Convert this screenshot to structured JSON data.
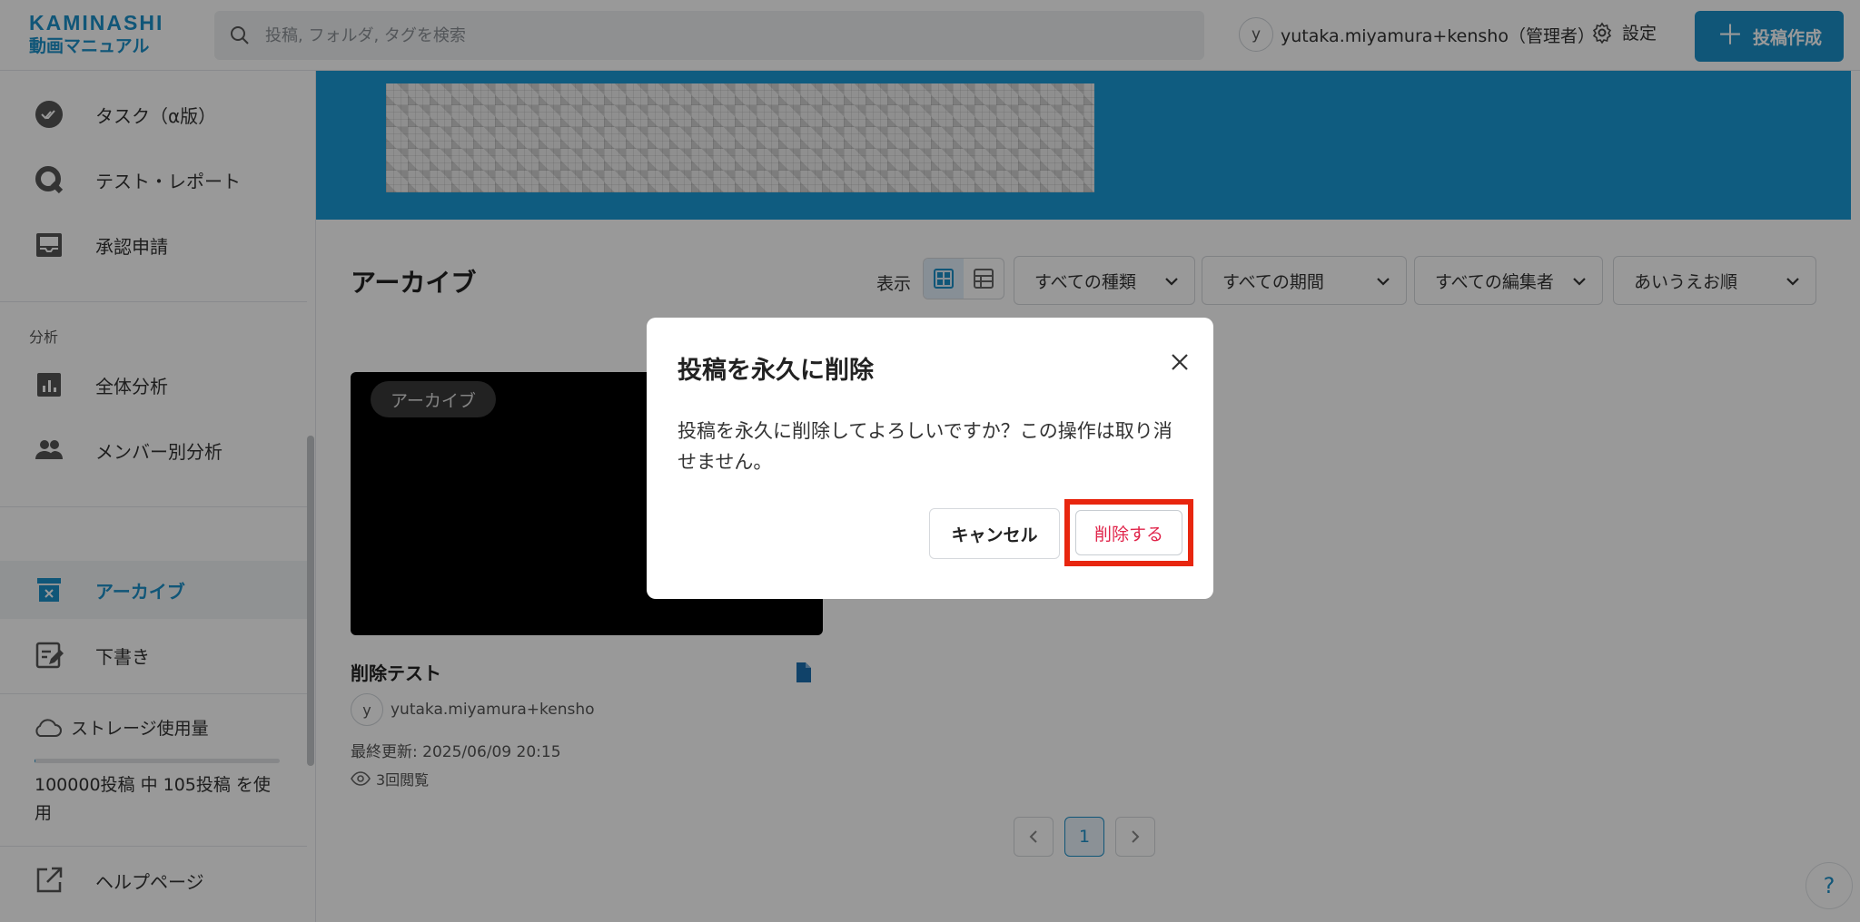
{
  "header": {
    "logo_brand": "KAMINASHI",
    "logo_sub": "動画マニュアル",
    "search_placeholder": "投稿, フォルダ, タグを検索",
    "user_initial": "y",
    "user_name": "yutaka.miyamura+kensho（管理者）",
    "settings_label": "設定",
    "create_label": "投稿作成"
  },
  "sidebar": {
    "items_top": [
      {
        "label": "タスク（α版）",
        "icon": "double-check-icon"
      },
      {
        "label": "テスト・レポート",
        "icon": "quiz-q-icon"
      },
      {
        "label": "承認申請",
        "icon": "inbox-tray-icon"
      }
    ],
    "section_analysis": "分析",
    "items_analysis": [
      {
        "label": "全体分析",
        "icon": "bar-chart-icon"
      },
      {
        "label": "メンバー別分析",
        "icon": "people-icon"
      }
    ],
    "items_bottom": [
      {
        "label": "アーカイブ",
        "icon": "archive-box-icon",
        "active": true
      },
      {
        "label": "下書き",
        "icon": "edit-note-icon"
      }
    ],
    "storage_title": "ストレージ使用量",
    "storage_text": "100000投稿 中 105投稿 を使用",
    "storage_fraction": 0.00105,
    "help_label": "ヘルプページ"
  },
  "main": {
    "title": "アーカイブ",
    "view_label": "表示",
    "filters": [
      "すべての種類",
      "すべての期間",
      "すべての編集者",
      "あいうえお順"
    ],
    "card": {
      "badge": "アーカイブ",
      "title": "削除テスト",
      "author_initial": "y",
      "author": "yutaka.miyamura+kensho",
      "updated": "最終更新: 2025/06/09 20:15",
      "views": "3回閲覧"
    },
    "pagination": {
      "current": "1"
    },
    "help_button": "?"
  },
  "modal": {
    "title": "投稿を永久に削除",
    "message": "投稿を永久に削除してよろしいですか？この操作は取り消せません。",
    "cancel_label": "キャンセル",
    "delete_label": "削除する"
  },
  "colors": {
    "accent": "#1b8fc9",
    "banner": "#1a9ad6",
    "danger": "#e0244a",
    "highlight": "#e8260f"
  }
}
